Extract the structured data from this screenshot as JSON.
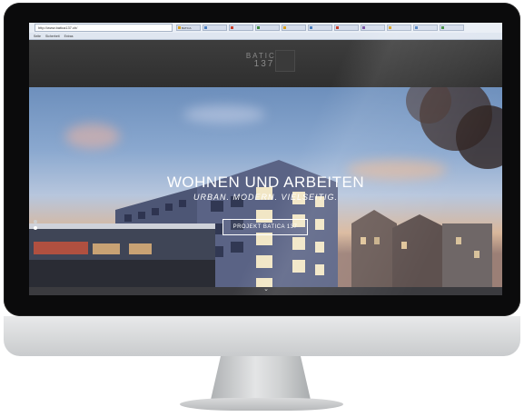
{
  "browser": {
    "address": "http://www.batica137.ch/",
    "tabs": [
      {
        "label": "BATICA",
        "color": "#d9a020"
      },
      {
        "label": "",
        "color": "#4a7fc1"
      },
      {
        "label": "",
        "color": "#c93f2b"
      },
      {
        "label": "",
        "color": "#3d8a3d"
      },
      {
        "label": "",
        "color": "#d9a020"
      },
      {
        "label": "",
        "color": "#4a7fc1"
      },
      {
        "label": "",
        "color": "#c93f2b"
      },
      {
        "label": "",
        "color": "#7a55a6"
      },
      {
        "label": "",
        "color": "#d9a020"
      },
      {
        "label": "",
        "color": "#4a7fc1"
      },
      {
        "label": "",
        "color": "#3d8a3d"
      }
    ],
    "menu": [
      "Seite",
      "Sicherheit",
      "Extras"
    ]
  },
  "site": {
    "logo": {
      "line1": "BATICA",
      "line2": "137"
    }
  },
  "hero": {
    "title": "WOHNEN UND ARBEITEN",
    "subtitle": "URBAN. MODERN. VIELSEITIG.",
    "button_label": "PROJEKT BATICA 137",
    "slides": 2,
    "active_slide": 2
  },
  "colors": {
    "header": "#333333",
    "sky_top": "#6d8fbc",
    "sky_horizon": "#d9b79b"
  }
}
